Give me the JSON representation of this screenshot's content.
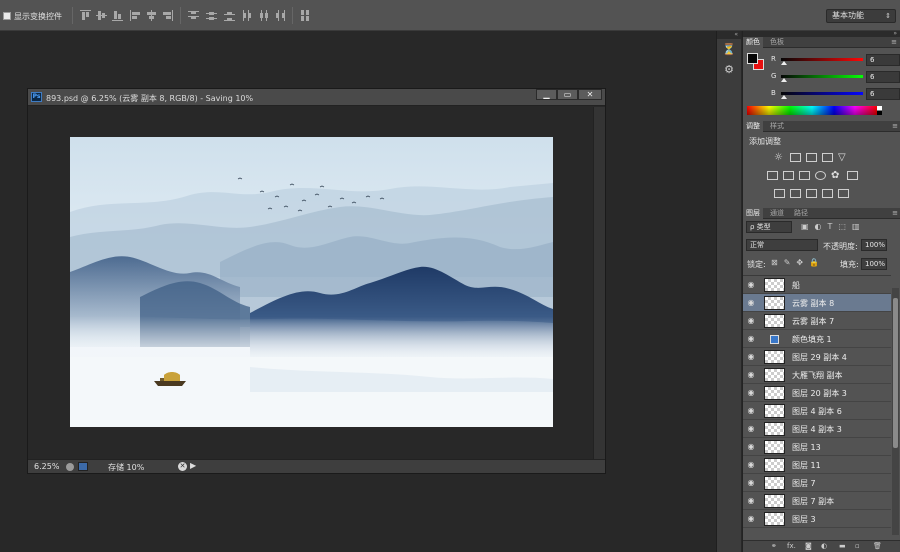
{
  "options_bar": {
    "show_transform_controls": "显示变换控件",
    "workspace": "基本功能"
  },
  "document": {
    "badge": "Ps",
    "title": "893.psd @ 6.25% (云雾 副本 8, RGB/8) - Saving 10%",
    "zoom": "6.25%",
    "status": "存储  10%"
  },
  "color_panel": {
    "tabs": [
      "颜色",
      "色板"
    ],
    "channels": [
      {
        "label": "R",
        "value": "6",
        "color": "#e02020"
      },
      {
        "label": "G",
        "value": "6",
        "color": "#16a316"
      },
      {
        "label": "B",
        "value": "6",
        "color": "#1f2fd8"
      }
    ],
    "foreground": "#060606",
    "background": "#e81010"
  },
  "adjust_panel": {
    "tabs": [
      "调整",
      "样式"
    ],
    "title": "添加调整"
  },
  "layers_panel": {
    "tabs": [
      "图层",
      "通道",
      "路径"
    ],
    "filter": "ρ 类型",
    "blend_mode": "正常",
    "opacity_label": "不透明度:",
    "opacity": "100%",
    "lock_label": "锁定:",
    "fill_label": "填充:",
    "fill": "100%",
    "layers": [
      {
        "name": "船",
        "selected": false,
        "type": "pixel"
      },
      {
        "name": "云雾 副本 8",
        "selected": true,
        "type": "pixel"
      },
      {
        "name": "云雾 副本 7",
        "selected": false,
        "type": "pixel"
      },
      {
        "name": "颜色填充 1",
        "selected": false,
        "type": "fill"
      },
      {
        "name": "图层 29 副本 4",
        "selected": false,
        "type": "pixel"
      },
      {
        "name": "大雁飞翔 副本",
        "selected": false,
        "type": "pixel"
      },
      {
        "name": "图层 20 副本 3",
        "selected": false,
        "type": "pixel"
      },
      {
        "name": "图层 4 副本 6",
        "selected": false,
        "type": "pixel"
      },
      {
        "name": "图层 4 副本 3",
        "selected": false,
        "type": "pixel"
      },
      {
        "name": "图层 13",
        "selected": false,
        "type": "pixel"
      },
      {
        "name": "图层 11",
        "selected": false,
        "type": "pixel"
      },
      {
        "name": "图层 7",
        "selected": false,
        "type": "pixel"
      },
      {
        "name": "图层 7 副本",
        "selected": false,
        "type": "pixel"
      },
      {
        "name": "图层 3",
        "selected": false,
        "type": "pixel"
      }
    ],
    "footer_icons": [
      "link-icon",
      "fx-icon",
      "mask-icon",
      "adjustment-icon",
      "group-icon",
      "new-layer-icon",
      "trash-icon"
    ]
  }
}
